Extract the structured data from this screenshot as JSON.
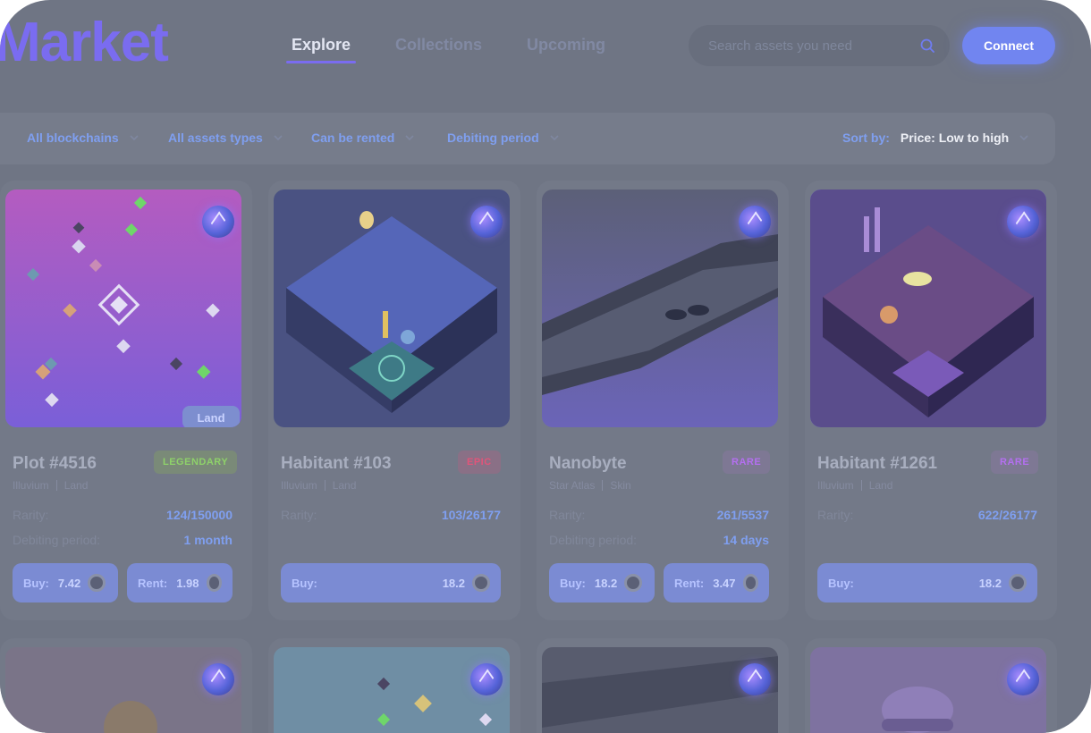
{
  "header": {
    "logo": "Market",
    "tabs": [
      {
        "label": "Explore"
      },
      {
        "label": "Collections"
      },
      {
        "label": "Upcoming"
      }
    ],
    "search_placeholder": "Search assets you need",
    "connect_label": "Connect"
  },
  "filters": {
    "blockchains": "All blockchains",
    "asset_types": "All assets types",
    "rentable": "Can be rented",
    "period": "Debiting period",
    "sort_label": "Sort by:",
    "sort_value": "Price: Low to high"
  },
  "cards": [
    {
      "title": "Plot #4516",
      "rarity": "LEGENDARY",
      "game": "Illuvium",
      "type": "Land",
      "image_tag": "Land",
      "rarity_label": "Rarity:",
      "rarity_value": "124/150000",
      "period_label": "Debiting period:",
      "period_value": "1 month",
      "buy_label": "Buy:",
      "buy_price": "7.42",
      "rent_label": "Rent:",
      "rent_price": "1.98"
    },
    {
      "title": "Habitant #103",
      "rarity": "EPIC",
      "game": "Illuvium",
      "type": "Land",
      "rarity_label": "Rarity:",
      "rarity_value": "103/26177",
      "buy_label": "Buy:",
      "buy_price": "18.2"
    },
    {
      "title": "Nanobyte",
      "rarity": "RARE",
      "game": "Star Atlas",
      "type": "Skin",
      "rarity_label": "Rarity:",
      "rarity_value": "261/5537",
      "period_label": "Debiting period:",
      "period_value": "14 days",
      "buy_label": "Buy:",
      "buy_price": "18.2",
      "rent_label": "Rent:",
      "rent_price": "3.47"
    },
    {
      "title": "Habitant #1261",
      "rarity": "RARE",
      "game": "Illuvium",
      "type": "Land",
      "rarity_label": "Rarity:",
      "rarity_value": "622/26177",
      "buy_label": "Buy:",
      "buy_price": "18.2"
    }
  ],
  "colors": {
    "accent": "#7a6cf0",
    "link": "#7f9ff0",
    "legendary": "#8ed16a",
    "epic": "#e0557a",
    "rare": "#b46ff0"
  }
}
